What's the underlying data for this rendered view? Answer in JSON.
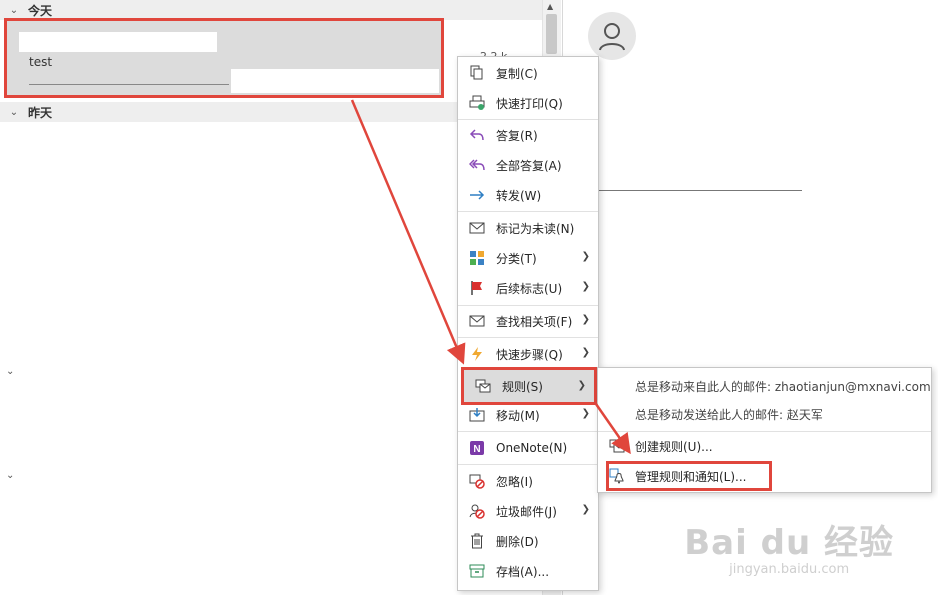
{
  "list": {
    "group_today": "今天",
    "group_yesterday": "昨天",
    "selected_message": {
      "subject": "test",
      "size": "2.2 k"
    }
  },
  "context_menu": {
    "items": [
      {
        "label": "复制(C)",
        "icon": "copy-icon"
      },
      {
        "label": "快速打印(Q)",
        "icon": "quick-print-icon"
      },
      {
        "label": "答复(R)",
        "icon": "reply-icon"
      },
      {
        "label": "全部答复(A)",
        "icon": "reply-all-icon"
      },
      {
        "label": "转发(W)",
        "icon": "forward-icon"
      },
      {
        "label": "标记为未读(N)",
        "icon": "mark-unread-icon"
      },
      {
        "label": "分类(T)",
        "icon": "categorize-icon"
      },
      {
        "label": "后续标志(U)",
        "icon": "flag-icon"
      },
      {
        "label": "查找相关项(F)",
        "icon": "find-related-icon"
      },
      {
        "label": "快速步骤(Q)",
        "icon": "quick-steps-icon"
      },
      {
        "label": "规则(S)",
        "icon": "rules-icon"
      },
      {
        "label": "移动(M)",
        "icon": "move-icon"
      },
      {
        "label": "OneNote(N)",
        "icon": "onenote-icon"
      },
      {
        "label": "忽略(I)",
        "icon": "ignore-icon"
      },
      {
        "label": "垃圾邮件(J)",
        "icon": "junk-icon"
      },
      {
        "label": "删除(D)",
        "icon": "delete-icon"
      },
      {
        "label": "存档(A)...",
        "icon": "archive-icon"
      }
    ]
  },
  "rules_submenu": {
    "hint_from": "总是移动来自此人的邮件: zhaotianjun@mxnavi.com",
    "hint_to": "总是移动发送给此人的邮件: 赵天军",
    "create_rule": "创建规则(U)...",
    "manage_rules": "管理规则和通知(L)..."
  },
  "watermark": {
    "brand": "Bai du 经验",
    "url": "jingyan.baidu.com"
  },
  "colors": {
    "annotation_red": "#e0463c",
    "selected_bg": "#dcdcdc",
    "menu_border": "#c6c6c6"
  }
}
